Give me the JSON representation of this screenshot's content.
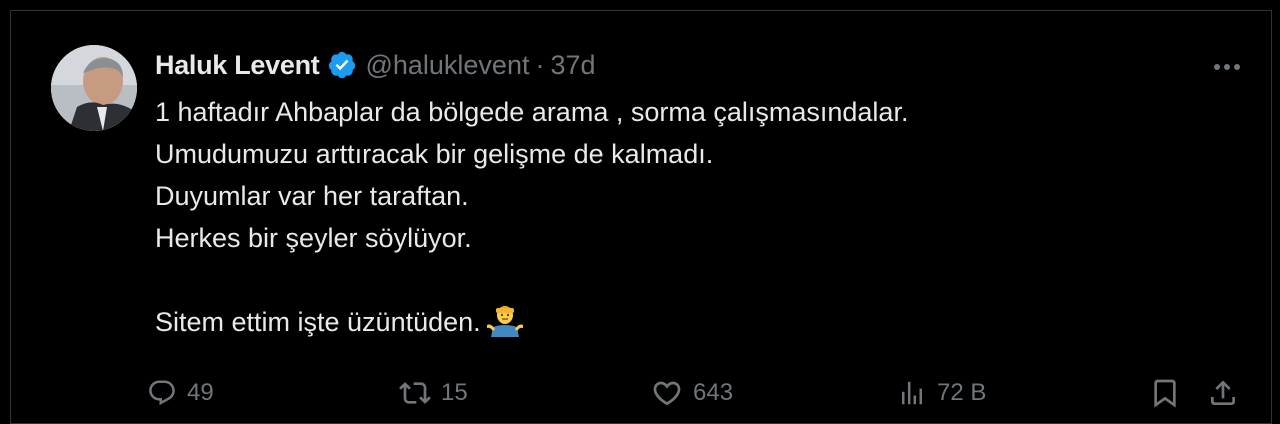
{
  "author": {
    "display_name": "Haluk Levent",
    "handle": "@haluklevent",
    "separator": "·",
    "time": "37d",
    "verified": true
  },
  "tweet": {
    "lines": [
      "1 haftadır Ahbaplar da bölgede arama , sorma çalışmasındalar.",
      "Umudumuzu arttıracak bir gelişme de kalmadı.",
      "Duyumlar var her taraftan.",
      "Herkes bir şeyler söylüyor.",
      "",
      "Sitem ettim işte üzüntüden."
    ],
    "emoji": "person-shrugging-emoji"
  },
  "actions": {
    "reply_count": "49",
    "retweet_count": "15",
    "like_count": "643",
    "views_count": "72 B"
  },
  "colors": {
    "background": "#000000",
    "text": "#e7e9ea",
    "secondary": "#71767b",
    "verified": "#1d9bf0",
    "border": "#2f3336"
  }
}
